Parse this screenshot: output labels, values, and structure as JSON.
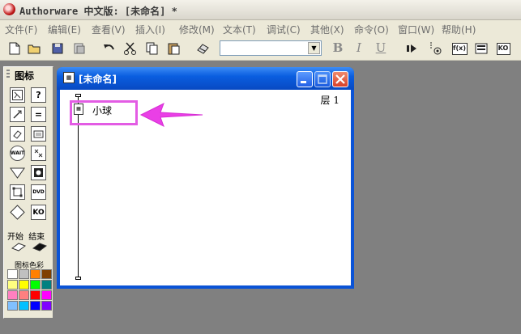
{
  "title_bar": {
    "text": "Authorware 中文版: [未命名] *"
  },
  "menu": [
    "文件(F)",
    "编辑(E)",
    "查看(V)",
    "插入(I)",
    "修改(M)",
    "文本(T)",
    "调试(C)",
    "其他(X)",
    "命令(O)",
    "窗口(W)",
    "帮助(H)"
  ],
  "toolbar": {
    "font_combo_value": "",
    "bold": "B",
    "italic": "I",
    "underline": "U",
    "fx_label": "f(x)",
    "ko_label": "KO"
  },
  "palette": {
    "title": "图标",
    "start_label": "开始",
    "end_label": "结束",
    "color_label": "图标色彩",
    "wait_label": "WAIT",
    "dvd_label": "DVD",
    "ko_label": "KO",
    "swatch_colors": [
      "#ffffff",
      "#c0c0c0",
      "#ff8000",
      "#804000",
      "#ffff80",
      "#ffff00",
      "#00ff00",
      "#008080",
      "#ff80c0",
      "#ff8080",
      "#ff0000",
      "#ff00ff",
      "#80c0ff",
      "#00c0ff",
      "#0000ff",
      "#8000ff"
    ]
  },
  "flow_window": {
    "title": "[未命名]",
    "layer_label": "层 1",
    "node_label": "小球"
  },
  "colors": {
    "highlight": "#e35ce4",
    "window_blue": "#0a53d6",
    "close_red": "#d8412a"
  }
}
